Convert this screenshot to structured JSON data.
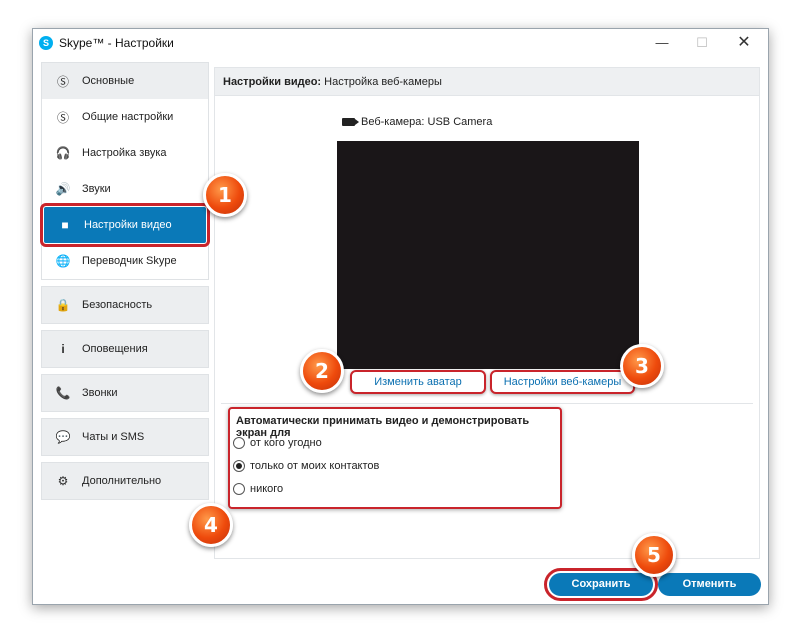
{
  "window": {
    "title": "Skype™ - Настройки",
    "controls": {
      "minimize": "—",
      "maximize": "☐",
      "close": "✕"
    }
  },
  "sidebar": {
    "groups": [
      {
        "id": "general",
        "header": {
          "label": "Основные",
          "icon": "skype-icon"
        },
        "items": [
          {
            "label": "Общие настройки",
            "icon": "skype-icon"
          },
          {
            "label": "Настройка звука",
            "icon": "headset-icon"
          },
          {
            "label": "Звуки",
            "icon": "speaker-icon"
          },
          {
            "label": "Настройки видео",
            "icon": "camera-icon",
            "active": true
          },
          {
            "label": "Переводчик Skype",
            "icon": "globe-icon"
          }
        ]
      },
      {
        "id": "security",
        "header": {
          "label": "Безопасность",
          "icon": "lock-icon"
        }
      },
      {
        "id": "notifications",
        "header": {
          "label": "Оповещения",
          "icon": "info-icon"
        }
      },
      {
        "id": "calls",
        "header": {
          "label": "Звонки",
          "icon": "phone-icon"
        }
      },
      {
        "id": "chats",
        "header": {
          "label": "Чаты и SMS",
          "icon": "chat-icon"
        }
      },
      {
        "id": "advanced",
        "header": {
          "label": "Дополнительно",
          "icon": "gear-icon"
        }
      }
    ]
  },
  "content": {
    "header_bold": "Настройки видео:",
    "header_rest": " Настройка веб-камеры",
    "webcam_label": "Веб-камера:",
    "webcam_value": "USB Camera",
    "change_avatar": "Изменить аватар",
    "webcam_settings": "Настройки веб-камеры",
    "auto_accept_title": "Автоматически принимать видео и демонстрировать экран для",
    "options": [
      {
        "label": "от кого угодно",
        "checked": false
      },
      {
        "label": "только от моих контактов",
        "checked": true
      },
      {
        "label": "никого",
        "checked": false
      }
    ]
  },
  "footer": {
    "save": "Сохранить",
    "cancel": "Отменить"
  },
  "badges": [
    "1",
    "2",
    "3",
    "4",
    "5"
  ],
  "colors": {
    "accent": "#0a79b8",
    "highlight": "#c9242b",
    "badge": "#ee4a0c"
  }
}
